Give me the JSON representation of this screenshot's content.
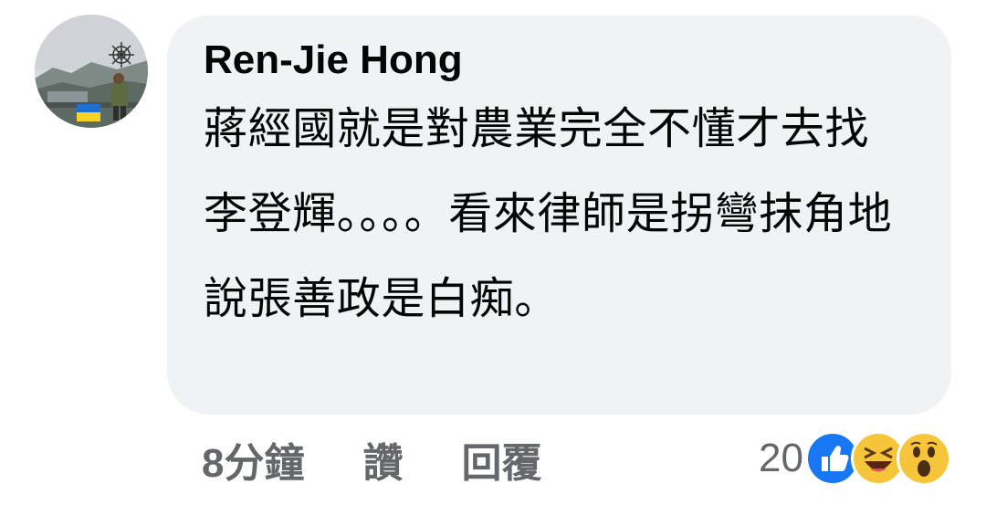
{
  "comment": {
    "author": "Ren-Jie Hong",
    "text": "蔣經國就是對農業完全不懂才去找李登輝。。。。看來律師是拐彎抹角地說張善政是白痴。"
  },
  "actions": {
    "timestamp": "8分鐘",
    "like_label": "讚",
    "reply_label": "回覆"
  },
  "reactions": {
    "count": "20",
    "icons": [
      "like-icon",
      "haha-icon",
      "wow-icon"
    ]
  },
  "colors": {
    "bubble": "#f0f2f5",
    "text": "#050505",
    "secondary": "#65676b",
    "like_blue": "#1877f2",
    "emoji_yellow": "#f7c53a"
  }
}
